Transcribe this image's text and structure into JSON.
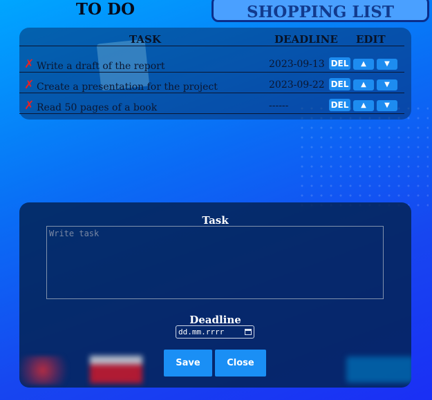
{
  "tabs": {
    "todo": "TO DO",
    "shopping": "SHOPPING LIST"
  },
  "table": {
    "headers": {
      "task": "TASK",
      "deadline": "DEADLINE",
      "edit": "EDIT"
    },
    "rows": [
      {
        "status": "✗",
        "task": "Write a draft of the report",
        "deadline": "2023-09-13",
        "del": "DEL",
        "up": "▲",
        "down": "▼"
      },
      {
        "status": "✗",
        "task": "Create a presentation for the project",
        "deadline": "2023-09-22",
        "del": "DEL",
        "up": "▲",
        "down": "▼"
      },
      {
        "status": "✗",
        "task": "Read 50 pages of a book",
        "deadline": "------",
        "del": "DEL",
        "up": "▲",
        "down": "▼"
      }
    ]
  },
  "form": {
    "task_label": "Task",
    "task_placeholder": "Write task",
    "deadline_label": "Deadline",
    "date_format": "dd.mm.rrrr",
    "save": "Save",
    "close": "Close"
  },
  "colors": {
    "accent": "#1d8cf0",
    "delete_mark": "#e82222",
    "shopping_tab": "#4aa0ff"
  }
}
